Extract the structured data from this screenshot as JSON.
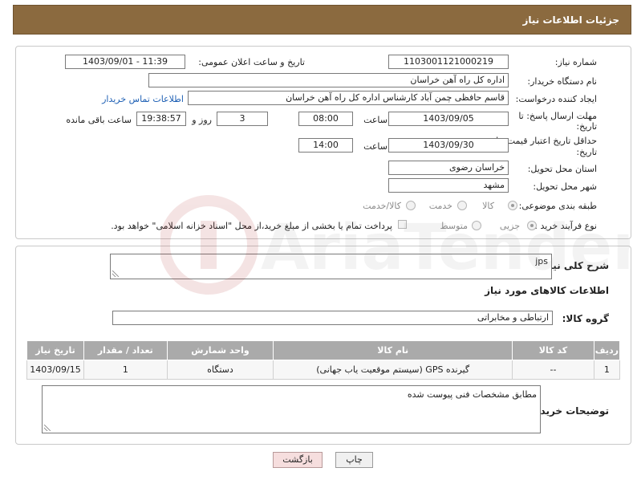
{
  "header": {
    "title": "جزئیات اطلاعات نیاز"
  },
  "form": {
    "need_number_label": "شماره نیاز:",
    "need_number": "1103001121000219",
    "announce_label": "تاریخ و ساعت اعلان عمومی:",
    "announce_value": "1403/09/01 - 11:39",
    "buyer_org_label": "نام دستگاه خریدار:",
    "buyer_org": "اداره کل راه آهن خراسان",
    "creator_label": "ایجاد کننده درخواست:",
    "creator": "قاسم حافظی چمن آباد کارشناس اداره کل راه آهن خراسان",
    "contact_link": "اطلاعات تماس خریدار",
    "deadline_label_1": "مهلت ارسال پاسخ: تا",
    "deadline_label_2": "تاریخ:",
    "deadline_date": "1403/09/05",
    "time_label": "ساعت",
    "deadline_time": "08:00",
    "days_value": "3",
    "days_label": "روز و",
    "remaining_time": "19:38:57",
    "remaining_label": "ساعت باقی مانده",
    "validity_label_1": "حداقل تاریخ اعتبار قیمت: تا",
    "validity_label_2": "تاریخ:",
    "validity_date": "1403/09/30",
    "validity_time": "14:00",
    "province_label": "استان محل تحویل:",
    "province": "خراسان رضوی",
    "city_label": "شهر محل تحویل:",
    "city": "مشهد",
    "category_label": "طبقه بندی موضوعی:",
    "category_options": [
      "کالا",
      "خدمت",
      "کالا/خدمت"
    ],
    "process_label": "نوع فرآیند خرید :",
    "process_options": [
      "جزیی",
      "متوسط"
    ],
    "payment_note": "پرداخت تمام یا بخشی از مبلغ خرید،از محل \"اسناد خزانه اسلامی\" خواهد بود."
  },
  "details": {
    "description_label": "شرح کلی نیاز:",
    "description_value": "jps",
    "items_title": "اطلاعات کالاهای مورد نیاز",
    "group_label": "گروه کالا:",
    "group_value": "ارتباطی و مخابراتی",
    "table": {
      "headers": [
        "ردیف",
        "کد کالا",
        "نام کالا",
        "واحد شمارش",
        "تعداد / مقدار",
        "تاریخ نیاز"
      ],
      "rows": [
        [
          "1",
          "--",
          "گیرنده GPS (سیستم موقعیت یاب جهانی)",
          "دستگاه",
          "1",
          "1403/09/15"
        ]
      ]
    },
    "buyer_notes_label": "توضیحات خریدار:",
    "buyer_notes_value": "مطابق مشخصات فنی پیوست شده"
  },
  "buttons": {
    "print": "چاپ",
    "back": "بازگشت"
  },
  "watermark": {
    "text": "AriaTender.net"
  },
  "colors": {
    "header_bg": "#8b6a3f",
    "table_header": "#aaaaaa",
    "link": "#1d5fb4"
  }
}
